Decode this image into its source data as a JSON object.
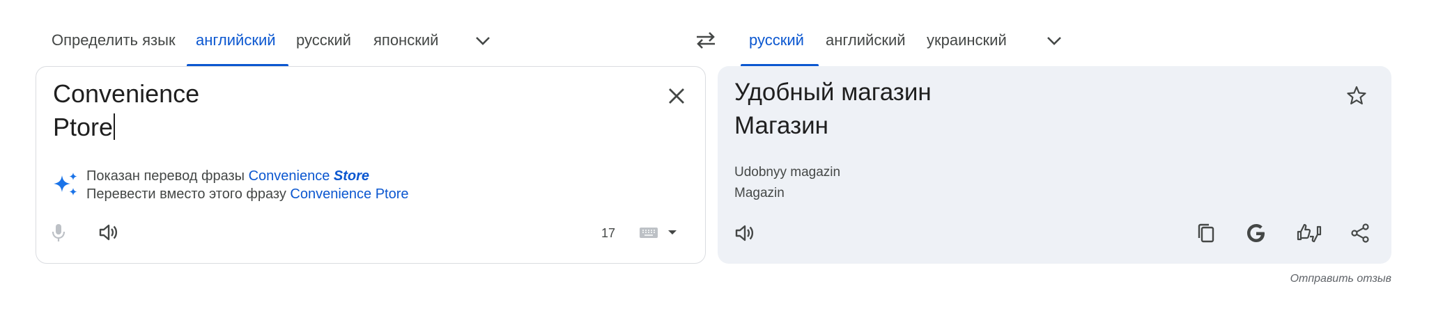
{
  "source_tabs": [
    {
      "label": "Определить язык",
      "active": false
    },
    {
      "label": "английский",
      "active": true
    },
    {
      "label": "русский",
      "active": false
    },
    {
      "label": "японский",
      "active": false
    }
  ],
  "target_tabs": [
    {
      "label": "русский",
      "active": true
    },
    {
      "label": "английский",
      "active": false
    },
    {
      "label": "украинский",
      "active": false
    }
  ],
  "source": {
    "lines": [
      "Convenience",
      "Ptore"
    ],
    "suggestion": {
      "shown_prefix": "Показан перевод фразы ",
      "shown_word1": "Convenience",
      "shown_word2": "Store",
      "instead_prefix": "Перевести вместо этого фразу ",
      "instead_phrase": "Convenience Ptore"
    },
    "char_count": "17"
  },
  "target": {
    "lines": [
      "Удобный магазин",
      "Магазин"
    ],
    "transliteration": [
      "Udobnyy magazin",
      "Magazin"
    ]
  },
  "feedback_label": "Отправить отзыв",
  "colors": {
    "accent": "#0b57d0",
    "target_bg": "#eef1f6",
    "sparkle": "#1a73e8"
  }
}
